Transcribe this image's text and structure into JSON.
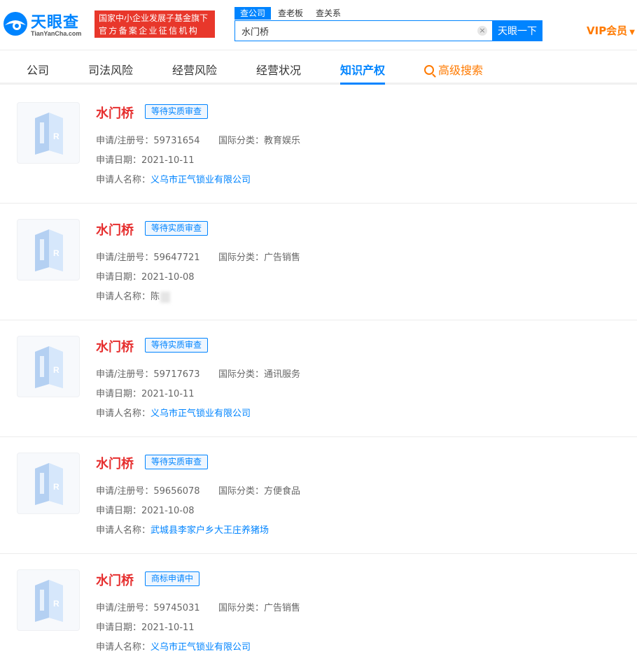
{
  "header": {
    "logo_text": "天眼查",
    "logo_sub": "TianYanCha.com",
    "gov_badge_line1": "国家中小企业发展子基金旗下",
    "gov_badge_line2": "官方备案企业征信机构",
    "search_tabs": [
      "查公司",
      "查老板",
      "查关系"
    ],
    "search_value": "水门桥",
    "clear_symbol": "×",
    "search_button": "天眼一下",
    "vip_label": "VIP会员",
    "vip_caret": "▼",
    "brand_color": "#0084ff",
    "vip_color": "#ff7a00"
  },
  "nav": {
    "items": [
      "公司",
      "司法风险",
      "经营风险",
      "经营状况",
      "知识产权",
      "高级搜索"
    ],
    "active": "知识产权"
  },
  "labels": {
    "reg_no": "申请/注册号：",
    "intl_class": "国际分类：",
    "apply_date": "申请日期：",
    "applicant": "申请人名称："
  },
  "trademarks": [
    {
      "name": "水门桥",
      "status": "等待实质审查",
      "reg_no": "59731654",
      "intl_class": "教育娱乐",
      "date": "2021-10-11",
      "applicant": "义乌市正气锁业有限公司",
      "applicant_link": true
    },
    {
      "name": "水门桥",
      "status": "等待实质审查",
      "reg_no": "59647721",
      "intl_class": "广告销售",
      "date": "2021-10-08",
      "applicant": "陈",
      "applicant_link": false
    },
    {
      "name": "水门桥",
      "status": "等待实质审查",
      "reg_no": "59717673",
      "intl_class": "通讯服务",
      "date": "2021-10-11",
      "applicant": "义乌市正气锁业有限公司",
      "applicant_link": true
    },
    {
      "name": "水门桥",
      "status": "等待实质审查",
      "reg_no": "59656078",
      "intl_class": "方便食品",
      "date": "2021-10-08",
      "applicant": "武城县李家户乡大王庄养猪场",
      "applicant_link": true
    },
    {
      "name": "水门桥",
      "status": "商标申请中",
      "reg_no": "59745031",
      "intl_class": "广告销售",
      "date": "2021-10-11",
      "applicant": "义乌市正气锁业有限公司",
      "applicant_link": true
    }
  ]
}
